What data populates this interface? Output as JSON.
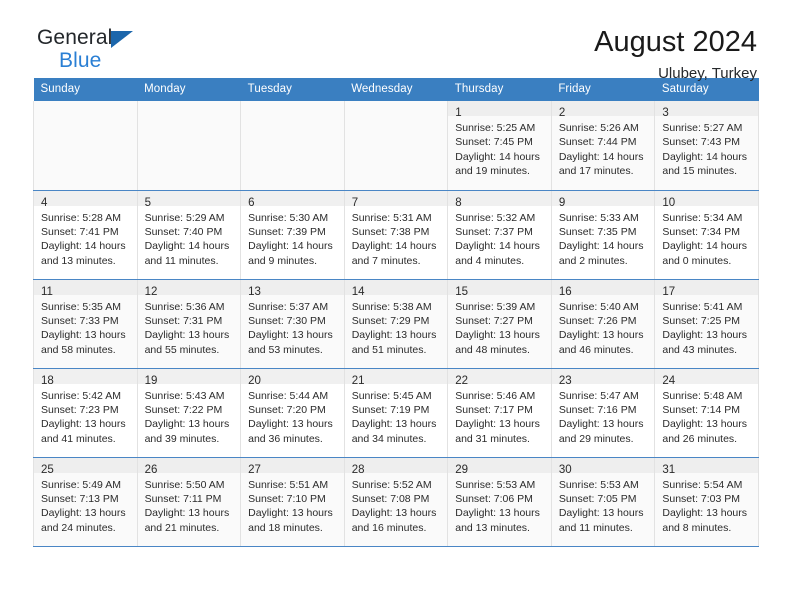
{
  "brand": {
    "line1": "General",
    "line2": "Blue",
    "flag_color": "#1c66ab",
    "accent_color": "#2a7fd4"
  },
  "header": {
    "title": "August 2024",
    "subtitle": "Ulubey, Turkey"
  },
  "theme": {
    "header_row_bg": "#3a7fc1",
    "header_row_text": "#ffffff",
    "row_separator": "#4a86c5",
    "cell_border": "#e2e2e2",
    "daynum_bg": "#eeeeee",
    "shaded_row_bg": "#fafafa"
  },
  "weekday_headers": [
    "Sunday",
    "Monday",
    "Tuesday",
    "Wednesday",
    "Thursday",
    "Friday",
    "Saturday"
  ],
  "weeks": [
    {
      "shaded": true,
      "days": [
        {
          "day": "",
          "lines": []
        },
        {
          "day": "",
          "lines": []
        },
        {
          "day": "",
          "lines": []
        },
        {
          "day": "",
          "lines": []
        },
        {
          "day": "1",
          "lines": [
            "Sunrise: 5:25 AM",
            "Sunset: 7:45 PM",
            "Daylight: 14 hours",
            "and 19 minutes."
          ]
        },
        {
          "day": "2",
          "lines": [
            "Sunrise: 5:26 AM",
            "Sunset: 7:44 PM",
            "Daylight: 14 hours",
            "and 17 minutes."
          ]
        },
        {
          "day": "3",
          "lines": [
            "Sunrise: 5:27 AM",
            "Sunset: 7:43 PM",
            "Daylight: 14 hours",
            "and 15 minutes."
          ]
        }
      ]
    },
    {
      "shaded": false,
      "days": [
        {
          "day": "4",
          "lines": [
            "Sunrise: 5:28 AM",
            "Sunset: 7:41 PM",
            "Daylight: 14 hours",
            "and 13 minutes."
          ]
        },
        {
          "day": "5",
          "lines": [
            "Sunrise: 5:29 AM",
            "Sunset: 7:40 PM",
            "Daylight: 14 hours",
            "and 11 minutes."
          ]
        },
        {
          "day": "6",
          "lines": [
            "Sunrise: 5:30 AM",
            "Sunset: 7:39 PM",
            "Daylight: 14 hours",
            "and 9 minutes."
          ]
        },
        {
          "day": "7",
          "lines": [
            "Sunrise: 5:31 AM",
            "Sunset: 7:38 PM",
            "Daylight: 14 hours",
            "and 7 minutes."
          ]
        },
        {
          "day": "8",
          "lines": [
            "Sunrise: 5:32 AM",
            "Sunset: 7:37 PM",
            "Daylight: 14 hours",
            "and 4 minutes."
          ]
        },
        {
          "day": "9",
          "lines": [
            "Sunrise: 5:33 AM",
            "Sunset: 7:35 PM",
            "Daylight: 14 hours",
            "and 2 minutes."
          ]
        },
        {
          "day": "10",
          "lines": [
            "Sunrise: 5:34 AM",
            "Sunset: 7:34 PM",
            "Daylight: 14 hours",
            "and 0 minutes."
          ]
        }
      ]
    },
    {
      "shaded": true,
      "days": [
        {
          "day": "11",
          "lines": [
            "Sunrise: 5:35 AM",
            "Sunset: 7:33 PM",
            "Daylight: 13 hours",
            "and 58 minutes."
          ]
        },
        {
          "day": "12",
          "lines": [
            "Sunrise: 5:36 AM",
            "Sunset: 7:31 PM",
            "Daylight: 13 hours",
            "and 55 minutes."
          ]
        },
        {
          "day": "13",
          "lines": [
            "Sunrise: 5:37 AM",
            "Sunset: 7:30 PM",
            "Daylight: 13 hours",
            "and 53 minutes."
          ]
        },
        {
          "day": "14",
          "lines": [
            "Sunrise: 5:38 AM",
            "Sunset: 7:29 PM",
            "Daylight: 13 hours",
            "and 51 minutes."
          ]
        },
        {
          "day": "15",
          "lines": [
            "Sunrise: 5:39 AM",
            "Sunset: 7:27 PM",
            "Daylight: 13 hours",
            "and 48 minutes."
          ]
        },
        {
          "day": "16",
          "lines": [
            "Sunrise: 5:40 AM",
            "Sunset: 7:26 PM",
            "Daylight: 13 hours",
            "and 46 minutes."
          ]
        },
        {
          "day": "17",
          "lines": [
            "Sunrise: 5:41 AM",
            "Sunset: 7:25 PM",
            "Daylight: 13 hours",
            "and 43 minutes."
          ]
        }
      ]
    },
    {
      "shaded": false,
      "days": [
        {
          "day": "18",
          "lines": [
            "Sunrise: 5:42 AM",
            "Sunset: 7:23 PM",
            "Daylight: 13 hours",
            "and 41 minutes."
          ]
        },
        {
          "day": "19",
          "lines": [
            "Sunrise: 5:43 AM",
            "Sunset: 7:22 PM",
            "Daylight: 13 hours",
            "and 39 minutes."
          ]
        },
        {
          "day": "20",
          "lines": [
            "Sunrise: 5:44 AM",
            "Sunset: 7:20 PM",
            "Daylight: 13 hours",
            "and 36 minutes."
          ]
        },
        {
          "day": "21",
          "lines": [
            "Sunrise: 5:45 AM",
            "Sunset: 7:19 PM",
            "Daylight: 13 hours",
            "and 34 minutes."
          ]
        },
        {
          "day": "22",
          "lines": [
            "Sunrise: 5:46 AM",
            "Sunset: 7:17 PM",
            "Daylight: 13 hours",
            "and 31 minutes."
          ]
        },
        {
          "day": "23",
          "lines": [
            "Sunrise: 5:47 AM",
            "Sunset: 7:16 PM",
            "Daylight: 13 hours",
            "and 29 minutes."
          ]
        },
        {
          "day": "24",
          "lines": [
            "Sunrise: 5:48 AM",
            "Sunset: 7:14 PM",
            "Daylight: 13 hours",
            "and 26 minutes."
          ]
        }
      ]
    },
    {
      "shaded": true,
      "days": [
        {
          "day": "25",
          "lines": [
            "Sunrise: 5:49 AM",
            "Sunset: 7:13 PM",
            "Daylight: 13 hours",
            "and 24 minutes."
          ]
        },
        {
          "day": "26",
          "lines": [
            "Sunrise: 5:50 AM",
            "Sunset: 7:11 PM",
            "Daylight: 13 hours",
            "and 21 minutes."
          ]
        },
        {
          "day": "27",
          "lines": [
            "Sunrise: 5:51 AM",
            "Sunset: 7:10 PM",
            "Daylight: 13 hours",
            "and 18 minutes."
          ]
        },
        {
          "day": "28",
          "lines": [
            "Sunrise: 5:52 AM",
            "Sunset: 7:08 PM",
            "Daylight: 13 hours",
            "and 16 minutes."
          ]
        },
        {
          "day": "29",
          "lines": [
            "Sunrise: 5:53 AM",
            "Sunset: 7:06 PM",
            "Daylight: 13 hours",
            "and 13 minutes."
          ]
        },
        {
          "day": "30",
          "lines": [
            "Sunrise: 5:53 AM",
            "Sunset: 7:05 PM",
            "Daylight: 13 hours",
            "and 11 minutes."
          ]
        },
        {
          "day": "31",
          "lines": [
            "Sunrise: 5:54 AM",
            "Sunset: 7:03 PM",
            "Daylight: 13 hours",
            "and 8 minutes."
          ]
        }
      ]
    }
  ]
}
